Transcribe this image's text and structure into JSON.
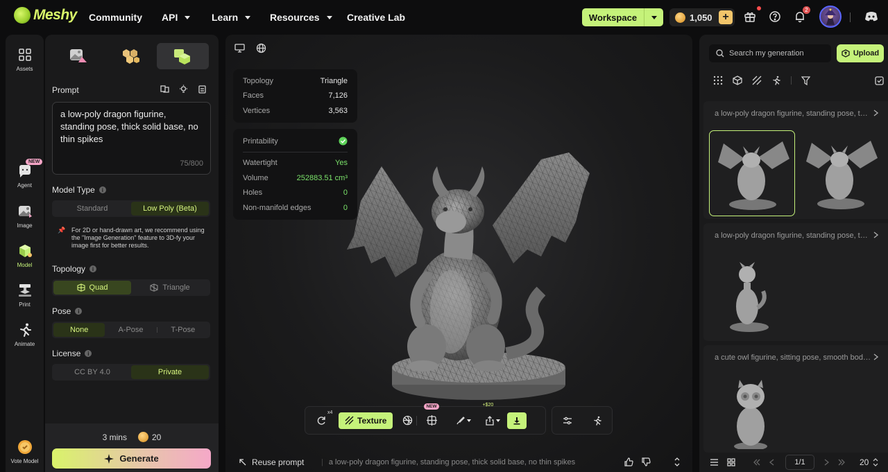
{
  "nav": {
    "logo": "Meshy",
    "items": [
      {
        "label": "Community",
        "dropdown": false
      },
      {
        "label": "API",
        "dropdown": true
      },
      {
        "label": "Learn",
        "dropdown": true
      },
      {
        "label": "Resources",
        "dropdown": true
      },
      {
        "label": "Creative Lab",
        "dropdown": false
      }
    ],
    "workspace_label": "Workspace",
    "credits": "1,050",
    "plus": "+",
    "notifications_count": "2",
    "icons": [
      "gift-icon",
      "help-icon",
      "bell-icon",
      "avatar",
      "discord-icon"
    ]
  },
  "rail": {
    "items": [
      {
        "label": "Assets",
        "icon": "grid-icon"
      },
      {
        "label": "Agent",
        "icon": "chat-icon",
        "tag": "NEW"
      },
      {
        "label": "Image",
        "icon": "image-icon"
      },
      {
        "label": "Model",
        "icon": "cube-icon"
      },
      {
        "label": "Print",
        "icon": "printer-icon"
      },
      {
        "label": "Animate",
        "icon": "running-icon"
      },
      {
        "label": "Vote Model",
        "icon": "vote-icon"
      }
    ]
  },
  "left_panel": {
    "prompt_label": "Prompt",
    "prompt_text": "a low-poly dragon figurine, standing pose, thick solid base, no thin spikes",
    "char_count": "75/800",
    "model_type": {
      "label": "Model Type",
      "options": [
        "Standard",
        "Low Poly (Beta)"
      ],
      "selected": "Low Poly (Beta)"
    },
    "hint_icon": "📌",
    "hint": "For 2D or hand-drawn art, we recommend using the \"Image Generation\" feature to 3D-fy your image first for better results.",
    "topology": {
      "label": "Topology",
      "options": [
        "Quad",
        "Triangle"
      ],
      "selected": "Quad"
    },
    "pose": {
      "label": "Pose",
      "options": [
        "None",
        "A-Pose",
        "T-Pose"
      ],
      "selected": "None"
    },
    "license": {
      "label": "License",
      "options": [
        "CC BY 4.0",
        "Private"
      ],
      "selected": "Private"
    },
    "time": "3 mins",
    "cost": "20",
    "generate_label": "Generate"
  },
  "viewport": {
    "mesh_stats": [
      {
        "label": "Topology",
        "value": "Triangle"
      },
      {
        "label": "Faces",
        "value": "7,126"
      },
      {
        "label": "Vertices",
        "value": "3,563"
      }
    ],
    "printability_label": "Printability",
    "printability": [
      {
        "label": "Watertight",
        "value": "Yes"
      },
      {
        "label": "Volume",
        "value": "252883.51 cm³"
      },
      {
        "label": "Holes",
        "value": "0"
      },
      {
        "label": "Non-manifold edges",
        "value": "0"
      }
    ],
    "toolbar": {
      "remesh_badge": "x4",
      "texture_label": "Texture",
      "new_tag": "NEW",
      "price_tag": "+$20"
    },
    "reuse_label": "Reuse prompt",
    "bottom_prompt": "a low-poly dragon figurine, standing pose, thick solid base, no thin spikes"
  },
  "right_panel": {
    "search_placeholder": "Search my generation",
    "upload_label": "Upload",
    "generations": [
      {
        "title": "a low-poly dragon figurine, standing pose, thick solid base, no thin spikes"
      },
      {
        "title": "a low-poly dragon figurine, standing pose, thick solid base, no thin spikes"
      },
      {
        "title": "a cute owl figurine, sitting pose, smooth body, thick solid base"
      }
    ],
    "pager": "1/1",
    "page_size": "20"
  },
  "colors": {
    "accent": "#c5f27a",
    "background": "#0d0d0e",
    "panel": "#1a1a1b",
    "success": "#7be26a"
  }
}
